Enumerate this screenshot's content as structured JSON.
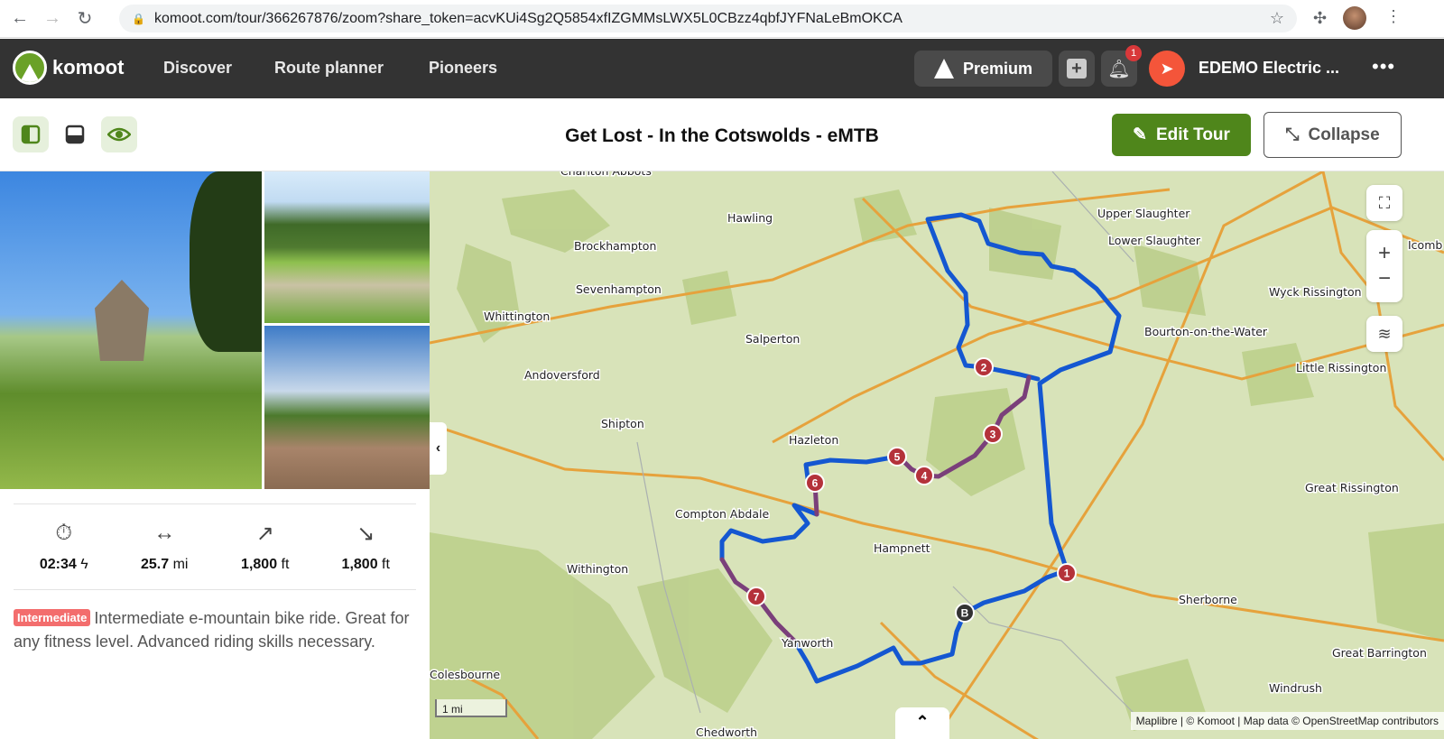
{
  "browser": {
    "url": "komoot.com/tour/366267876/zoom?share_token=acvKUi4Sg2Q5854xfIZGMMsLWX5L0CBzz4qbfJYFNaLeBmOKCA"
  },
  "header": {
    "brand": "komoot",
    "nav": [
      "Discover",
      "Route planner",
      "Pioneers"
    ],
    "premium": "Premium",
    "notifications": "1",
    "user": "EDEMO Electric ...",
    "more": "•••"
  },
  "tour": {
    "title": "Get Lost - In the Cotswolds - eMTB",
    "edit": "Edit Tour",
    "collapse": "Collapse"
  },
  "stats": [
    {
      "icon": "stopwatch-icon",
      "value": "02:34",
      "unit": "ϟ"
    },
    {
      "icon": "distance-icon",
      "value": "25.7",
      "unit": "mi"
    },
    {
      "icon": "uphill-icon",
      "value": "1,800",
      "unit": "ft"
    },
    {
      "icon": "downhill-icon",
      "value": "1,800",
      "unit": "ft"
    }
  ],
  "difficulty": "Intermediate",
  "description": "Intermediate e-mountain bike ride. Great for any fitness level. Advanced riding skills necessary.",
  "map": {
    "places": [
      "Charlton Abbots",
      "Hawling",
      "Brockhampton",
      "Sevenhampton",
      "Whittington",
      "Salperton",
      "Andoversford",
      "Shipton",
      "Hazleton",
      "Compton Abdale",
      "Hampnett",
      "Withington",
      "Yanworth",
      "Colesbourne",
      "Chedworth",
      "Upper Slaughter",
      "Lower Slaughter",
      "Wyck Rissington",
      "Bourton-on-the-Water",
      "Little Rissington",
      "Great Rissington",
      "Sherborne",
      "Great Barrington",
      "Windrush",
      "Icomb"
    ],
    "waypoints": [
      "1",
      "2",
      "3",
      "4",
      "5",
      "6",
      "7"
    ],
    "start": "B",
    "scale": "1 mi",
    "attribution": "Maplibre | © Komoot | Map data © OpenStreetMap contributors",
    "route_color": "#1457d1",
    "highlight_color": "#7a3f7a"
  }
}
